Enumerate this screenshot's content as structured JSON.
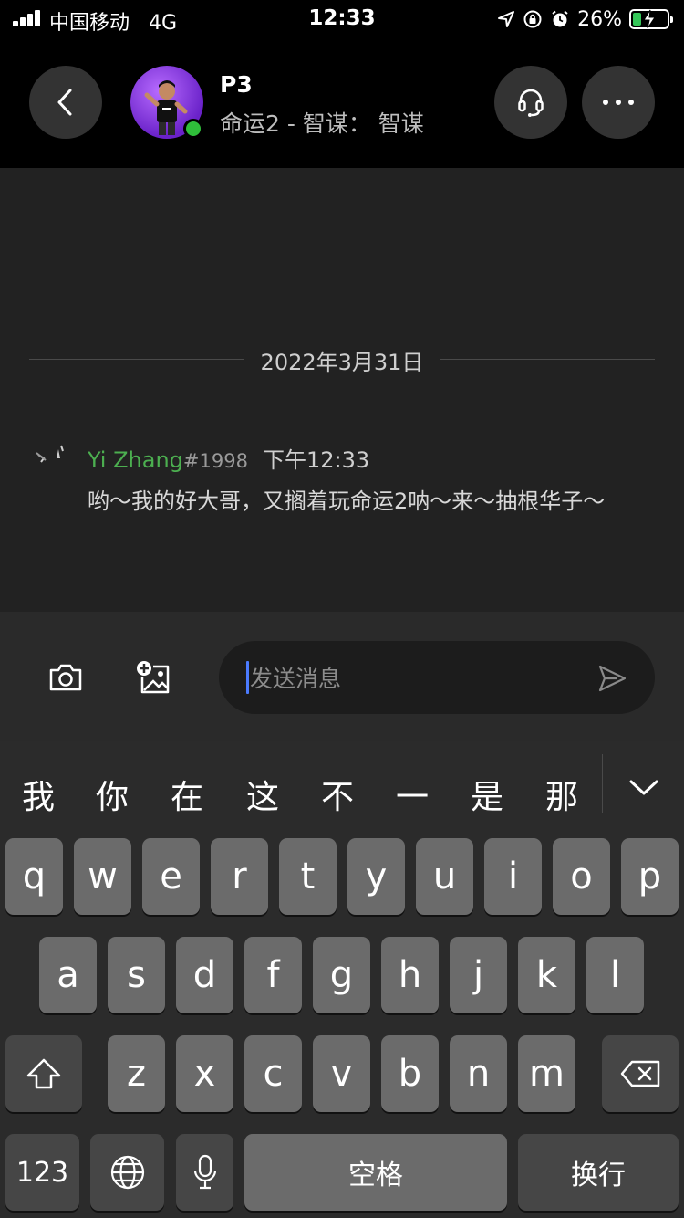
{
  "status_bar": {
    "carrier": "中国移动",
    "network": "4G",
    "time": "12:33",
    "battery_percent": "26%",
    "battery_level": 0.26,
    "icons": [
      "signal-icon",
      "location-icon",
      "orientation-lock-icon",
      "alarm-icon",
      "battery-charging-icon"
    ]
  },
  "header": {
    "contact_name": "P3",
    "contact_status": "命运2 - 智谋：  智谋",
    "online": true,
    "icons": [
      "back-icon",
      "headset-icon",
      "more-icon"
    ]
  },
  "chat": {
    "date_separator": "2022年3月31日",
    "messages": [
      {
        "author": "Yi Zhang",
        "tag": "#1998",
        "time": "下午12:33",
        "text": "哟～我的好大哥，又搁着玩命运2呐～来～抽根华子～"
      }
    ]
  },
  "composer": {
    "placeholder": "发送消息",
    "icons": [
      "camera-icon",
      "add-image-icon",
      "send-icon"
    ]
  },
  "keyboard": {
    "candidates": [
      "我",
      "你",
      "在",
      "这",
      "不",
      "一",
      "是",
      "那"
    ],
    "row1": [
      "q",
      "w",
      "e",
      "r",
      "t",
      "y",
      "u",
      "i",
      "o",
      "p"
    ],
    "row2": [
      "a",
      "s",
      "d",
      "f",
      "g",
      "h",
      "j",
      "k",
      "l"
    ],
    "row3": [
      "z",
      "x",
      "c",
      "v",
      "b",
      "n",
      "m"
    ],
    "numbers_key": "123",
    "space_key": "空格",
    "return_key": "换行",
    "icons": [
      "chevron-down-icon",
      "shift-icon",
      "backspace-icon",
      "globe-icon",
      "microphone-icon"
    ]
  },
  "colors": {
    "online_green": "#2fbe3a",
    "author_green": "#4caf50",
    "caret_blue": "#4b7bff",
    "chat_background": "#222222"
  }
}
